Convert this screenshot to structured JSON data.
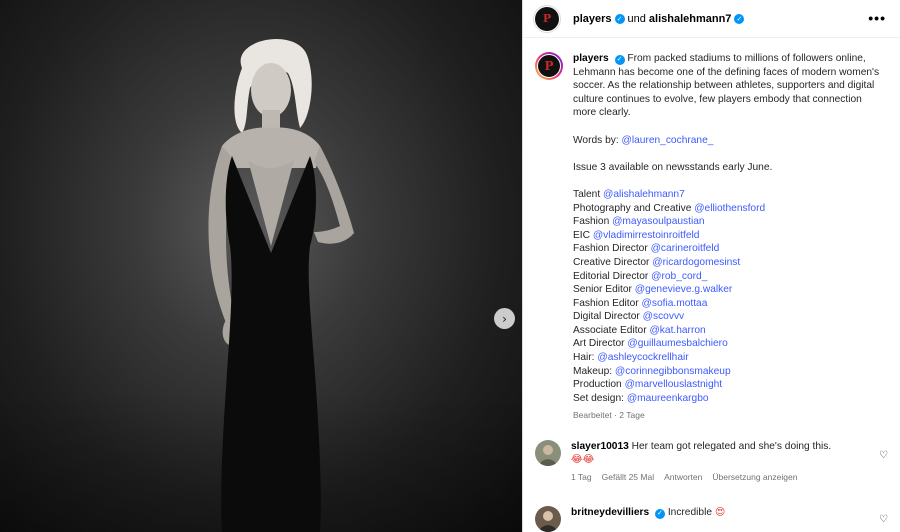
{
  "header": {
    "account": "players",
    "joiner": "und",
    "coauthor": "alishalehmann7",
    "more_glyph": "•••",
    "verified_glyph": "✓"
  },
  "photo": {
    "next_glyph": "›"
  },
  "caption": {
    "username": "players",
    "lines": [
      "From packed stadiums to millions of followers online, Lehmann has become one of the defining faces of modern women's soccer. As the relationship between athletes, supporters and digital culture continues to evolve, few players embody that connection more clearly."
    ],
    "words_by_label": "Words by:",
    "words_by_handle": "@lauren_cochrane_",
    "issue_note": "Issue 3 available on newsstands early June.",
    "credits": [
      {
        "role": "Talent",
        "handle": "@alishalehmann7"
      },
      {
        "role": "Photography and Creative",
        "handle": "@elliothensford"
      },
      {
        "role": "Fashion",
        "handle": "@mayasoulpaustian"
      },
      {
        "role": "EIC",
        "handle": "@vladimirrestoinroitfeld"
      },
      {
        "role": "Fashion Director",
        "handle": "@carineroitfeld"
      },
      {
        "role": "Creative Director",
        "handle": "@ricardogomesinst"
      },
      {
        "role": "Editorial Director",
        "handle": "@rob_cord_"
      },
      {
        "role": "Senior Editor",
        "handle": "@genevieve.g.walker"
      },
      {
        "role": "Fashion Editor",
        "handle": "@sofia.mottaa"
      },
      {
        "role": "Digital Director",
        "handle": "@scovvv"
      },
      {
        "role": "Associate Editor",
        "handle": "@kat.harron"
      },
      {
        "role": "Art Director",
        "handle": "@guillaumesbalchiero"
      },
      {
        "role": "Hair:",
        "handle": "@ashleycockrellhair"
      },
      {
        "role": "Makeup:",
        "handle": "@corinnegibbonsmakeup"
      },
      {
        "role": "Production",
        "handle": "@marvellouslastnight"
      },
      {
        "role": "Set design:",
        "handle": "@maureenkargbo"
      }
    ],
    "edited": "Bearbeitet · 2 Tage"
  },
  "comments": [
    {
      "username": "slayer10013",
      "text": "Her team got relegated and she's doing this.",
      "emojis": "😂😂",
      "age": "1 Tag",
      "likes": "Gefällt 25 Mal",
      "reply": "Antworten",
      "translate": "Übersetzung anzeigen"
    },
    {
      "username": "britneydevilliers",
      "text": "Incredible",
      "emojis": "😍"
    }
  ],
  "icons": {
    "heart": "♡"
  }
}
